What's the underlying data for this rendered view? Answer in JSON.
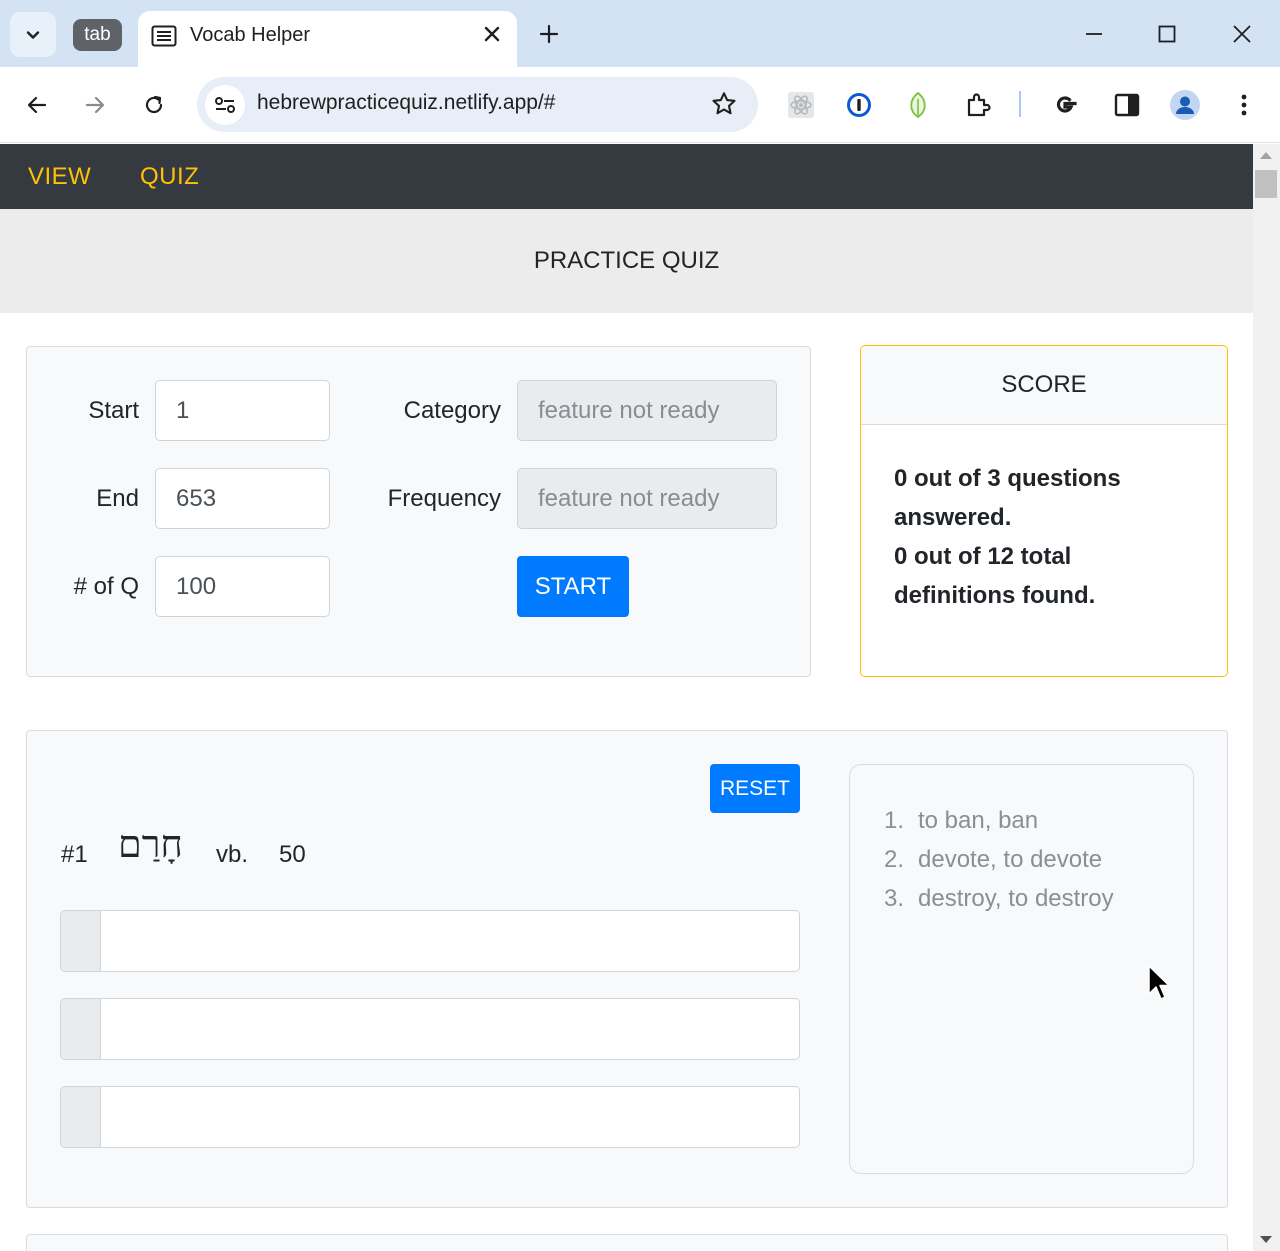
{
  "browser": {
    "tab_group_label": "tab",
    "tab_title": "Vocab Helper",
    "url": "hebrewpracticequiz.netlify.app/#"
  },
  "nav": {
    "links": [
      "VIEW",
      "QUIZ"
    ]
  },
  "header": {
    "title": "PRACTICE QUIZ"
  },
  "settings": {
    "start_label": "Start",
    "start_value": "1",
    "end_label": "End",
    "end_value": "653",
    "num_q_label": "# of Q",
    "num_q_value": "100",
    "category_label": "Category",
    "category_placeholder": "feature not ready",
    "frequency_label": "Frequency",
    "frequency_placeholder": "feature not ready",
    "start_button": "START"
  },
  "score": {
    "title": "SCORE",
    "line1": "0 out of 3 questions answered.",
    "line2": "0 out of 12 total definitions found."
  },
  "question": {
    "number": "#1",
    "word": "חָרַם",
    "pos": "vb.",
    "frequency": "50",
    "reset_button": "RESET",
    "definitions": [
      "to ban, ban",
      "devote, to devote",
      "destroy, to destroy"
    ]
  },
  "colors": {
    "navbar": "#343a40",
    "nav_link": "#ffc107",
    "primary": "#007bff",
    "score_border": "#ffc107"
  }
}
